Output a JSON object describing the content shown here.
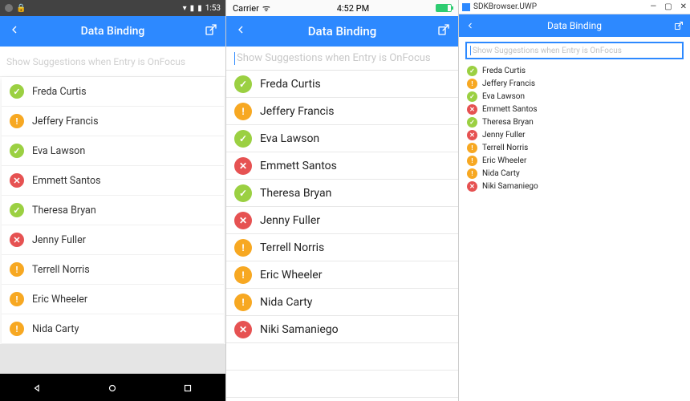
{
  "android": {
    "status": {
      "time": "1:53"
    },
    "header": {
      "title": "Data Binding",
      "back_icon": "chevron-left",
      "action_icon": "external-link"
    },
    "search_placeholder": "Show Suggestions when Entry is OnFocus",
    "items": [
      {
        "name": "Freda Curtis",
        "status": "check"
      },
      {
        "name": "Jeffery Francis",
        "status": "warn"
      },
      {
        "name": "Eva Lawson",
        "status": "check"
      },
      {
        "name": "Emmett Santos",
        "status": "err"
      },
      {
        "name": "Theresa Bryan",
        "status": "check"
      },
      {
        "name": "Jenny Fuller",
        "status": "err"
      },
      {
        "name": "Terrell Norris",
        "status": "warn"
      },
      {
        "name": "Eric Wheeler",
        "status": "warn"
      },
      {
        "name": "Nida Carty",
        "status": "warn"
      }
    ]
  },
  "ios": {
    "status": {
      "carrier": "Carrier",
      "time": "4:52 PM"
    },
    "header": {
      "title": "Data Binding",
      "back_icon": "chevron-left",
      "action_icon": "external-link"
    },
    "search_placeholder": "Show Suggestions when Entry is OnFocus",
    "items": [
      {
        "name": "Freda Curtis",
        "status": "check"
      },
      {
        "name": "Jeffery Francis",
        "status": "warn"
      },
      {
        "name": "Eva Lawson",
        "status": "check"
      },
      {
        "name": "Emmett Santos",
        "status": "err"
      },
      {
        "name": "Theresa Bryan",
        "status": "check"
      },
      {
        "name": "Jenny Fuller",
        "status": "err"
      },
      {
        "name": "Terrell Norris",
        "status": "warn"
      },
      {
        "name": "Eric Wheeler",
        "status": "warn"
      },
      {
        "name": "Nida Carty",
        "status": "warn"
      },
      {
        "name": "Niki Samaniego",
        "status": "err"
      }
    ]
  },
  "uwp": {
    "window_title": "SDKBrowser.UWP",
    "header": {
      "title": "Data Binding",
      "back_icon": "chevron-left",
      "action_icon": "external-link"
    },
    "search_placeholder": "Show Suggestions when Entry is OnFocus",
    "items": [
      {
        "name": "Freda Curtis",
        "status": "check"
      },
      {
        "name": "Jeffery Francis",
        "status": "warn"
      },
      {
        "name": "Eva Lawson",
        "status": "check"
      },
      {
        "name": "Emmett Santos",
        "status": "err"
      },
      {
        "name": "Theresa Bryan",
        "status": "check"
      },
      {
        "name": "Jenny Fuller",
        "status": "err"
      },
      {
        "name": "Terrell Norris",
        "status": "warn"
      },
      {
        "name": "Eric Wheeler",
        "status": "warn"
      },
      {
        "name": "Nida Carty",
        "status": "warn"
      },
      {
        "name": "Niki Samaniego",
        "status": "err"
      }
    ]
  }
}
